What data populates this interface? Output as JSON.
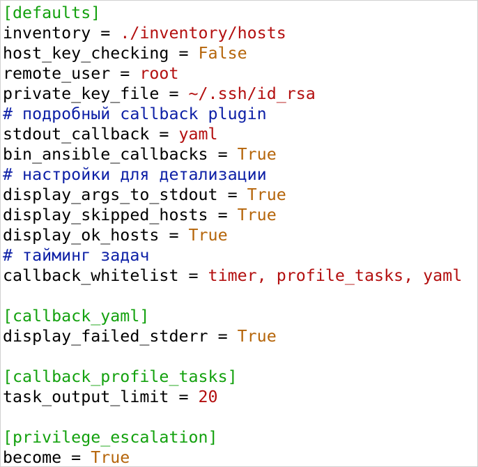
{
  "colors": {
    "section": "#13a10e",
    "comment": "#0c1fa6",
    "string": "#b30f0f",
    "boolean": "#b5650a",
    "number": "#b30f0f",
    "text": "#000000",
    "background": "#ffffff"
  },
  "lines": [
    [
      {
        "t": "section",
        "v": "[defaults]"
      }
    ],
    [
      {
        "t": "plain",
        "v": "inventory = "
      },
      {
        "t": "string",
        "v": "./inventory/hosts"
      }
    ],
    [
      {
        "t": "plain",
        "v": "host_key_checking = "
      },
      {
        "t": "bool",
        "v": "False"
      }
    ],
    [
      {
        "t": "plain",
        "v": "remote_user = "
      },
      {
        "t": "string",
        "v": "root"
      }
    ],
    [
      {
        "t": "plain",
        "v": "private_key_file = "
      },
      {
        "t": "string",
        "v": "~/.ssh/id_rsa"
      }
    ],
    [
      {
        "t": "comment",
        "v": "# подробный callback plugin"
      }
    ],
    [
      {
        "t": "plain",
        "v": "stdout_callback = "
      },
      {
        "t": "string",
        "v": "yaml"
      }
    ],
    [
      {
        "t": "plain",
        "v": "bin_ansible_callbacks = "
      },
      {
        "t": "bool",
        "v": "True"
      }
    ],
    [
      {
        "t": "comment",
        "v": "# настройки для детализации"
      }
    ],
    [
      {
        "t": "plain",
        "v": "display_args_to_stdout = "
      },
      {
        "t": "bool",
        "v": "True"
      }
    ],
    [
      {
        "t": "plain",
        "v": "display_skipped_hosts = "
      },
      {
        "t": "bool",
        "v": "True"
      }
    ],
    [
      {
        "t": "plain",
        "v": "display_ok_hosts = "
      },
      {
        "t": "bool",
        "v": "True"
      }
    ],
    [
      {
        "t": "comment",
        "v": "# тайминг задач"
      }
    ],
    [
      {
        "t": "plain",
        "v": "callback_whitelist = "
      },
      {
        "t": "string",
        "v": "timer, profile_tasks, yaml"
      }
    ],
    [],
    [
      {
        "t": "section",
        "v": "[callback_yaml]"
      }
    ],
    [
      {
        "t": "plain",
        "v": "display_failed_stderr = "
      },
      {
        "t": "bool",
        "v": "True"
      }
    ],
    [],
    [
      {
        "t": "section",
        "v": "[callback_profile_tasks]"
      }
    ],
    [
      {
        "t": "plain",
        "v": "task_output_limit = "
      },
      {
        "t": "number",
        "v": "20"
      }
    ],
    [],
    [
      {
        "t": "section",
        "v": "[privilege_escalation]"
      }
    ],
    [
      {
        "t": "plain",
        "v": "become = "
      },
      {
        "t": "bool",
        "v": "True"
      }
    ]
  ]
}
